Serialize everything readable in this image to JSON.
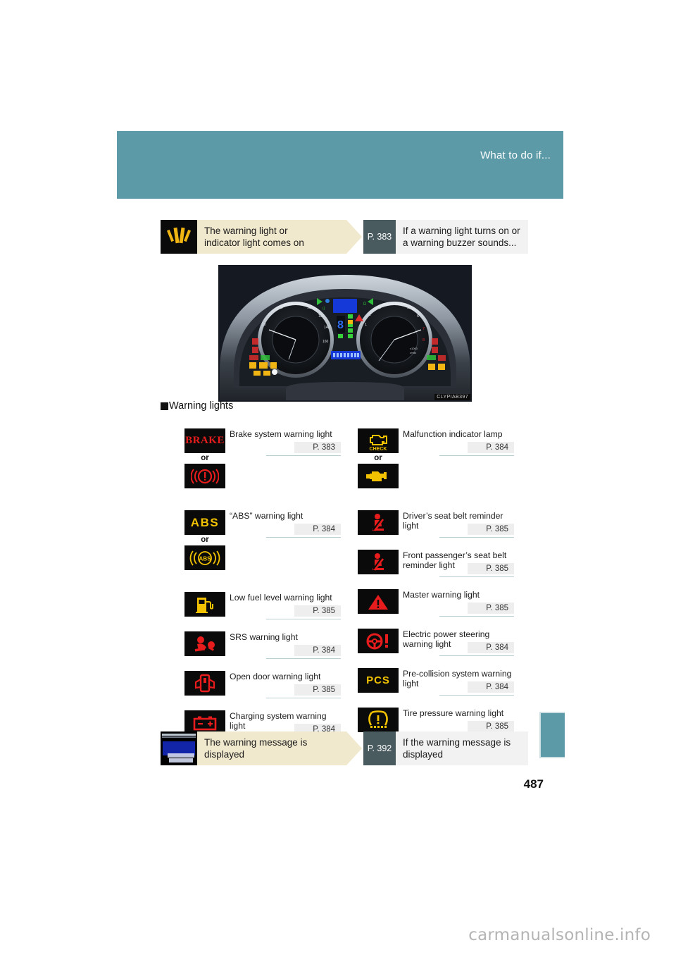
{
  "header": {
    "title": "What to do if..."
  },
  "top_banner": {
    "icon_name": "warning-flare-icon",
    "condition": "The warning light or indicator light comes on",
    "page_ref": "P. 383",
    "result": "If a warning light turns on or a warning buzzer sounds..."
  },
  "photo": {
    "caption": "CLYPIAB397",
    "alt": "instrument-cluster-photo"
  },
  "section": {
    "heading": "Warning lights"
  },
  "warning_lights": {
    "left_column": [
      {
        "icons": [
          "BRAKE",
          "brake-circle-exclamation"
        ],
        "or_label": "or",
        "label": "Brake system warning light",
        "page_ref": "P. 383"
      },
      {
        "icons": [
          "ABS",
          "abs-circle"
        ],
        "or_label": "or",
        "label": "“ABS” warning light",
        "page_ref": "P. 384"
      },
      {
        "icons": [
          "fuel-pump"
        ],
        "label": "Low fuel level warning light",
        "page_ref": "P. 385"
      },
      {
        "icons": [
          "srs-airbag"
        ],
        "label": "SRS warning light",
        "page_ref": "P. 384"
      },
      {
        "icons": [
          "open-door"
        ],
        "label": "Open door warning light",
        "page_ref": "P. 385"
      },
      {
        "icons": [
          "battery"
        ],
        "label": "Charging system warning light",
        "page_ref": "P. 384"
      }
    ],
    "right_column": [
      {
        "icons": [
          "engine-check",
          "engine"
        ],
        "or_label": "or",
        "label": "Malfunction indicator lamp",
        "page_ref": "P. 384"
      },
      {
        "icons": [
          "seat-belt"
        ],
        "label": "Driver’s seat belt reminder light",
        "page_ref": "P. 385"
      },
      {
        "icons": [
          "seat-belt"
        ],
        "label": "Front passenger’s seat belt reminder light",
        "page_ref": "P. 385"
      },
      {
        "icons": [
          "master-warning-triangle"
        ],
        "label": "Master warning light",
        "page_ref": "P. 385"
      },
      {
        "icons": [
          "steering-wheel-exclamation"
        ],
        "label": "Electric power steering warning light",
        "page_ref": "P. 384"
      },
      {
        "icons": [
          "PCS"
        ],
        "label": "Pre-collision system warning light",
        "page_ref": "P. 384"
      },
      {
        "icons": [
          "tire-pressure"
        ],
        "label": "Tire pressure warning light",
        "page_ref": "P. 385"
      }
    ]
  },
  "bottom_banner": {
    "icon_name": "key-not-detected-display-icon",
    "icon_text_line1": "KEY IS NOT",
    "icon_text_line2": "DETECTED",
    "condition": "The warning message is displayed",
    "page_ref": "P. 392",
    "result": "If the warning message is displayed"
  },
  "folio": "487",
  "watermark": "carmanualsonline.info",
  "colors": {
    "teal": "#5c9aa8",
    "cream": "#f1e9ce",
    "slate": "#4a5b60",
    "light_gray": "#f2f2f2",
    "icon_red": "#e81c1c",
    "icon_amber": "#f2c200"
  }
}
